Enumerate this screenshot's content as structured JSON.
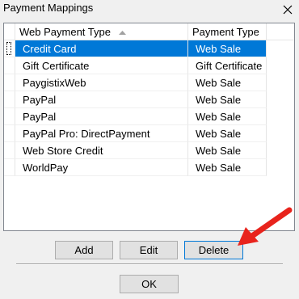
{
  "window": {
    "title": "Payment Mappings",
    "close_glyph": "✕"
  },
  "list": {
    "columns": [
      {
        "label": "Web Payment Type",
        "sort": "ascending"
      },
      {
        "label": "Payment Type"
      }
    ],
    "rows": [
      {
        "web_payment_type": "Credit Card",
        "payment_type": "Web Sale",
        "selected": true
      },
      {
        "web_payment_type": "Gift Certificate",
        "payment_type": "Gift Certificate"
      },
      {
        "web_payment_type": "PaygistixWeb",
        "payment_type": "Web Sale"
      },
      {
        "web_payment_type": "PayPal",
        "payment_type": "Web Sale"
      },
      {
        "web_payment_type": "PayPal",
        "payment_type": "Web Sale"
      },
      {
        "web_payment_type": "PayPal Pro: DirectPayment",
        "payment_type": "Web Sale"
      },
      {
        "web_payment_type": "Web Store Credit",
        "payment_type": "Web Sale"
      },
      {
        "web_payment_type": "WorldPay",
        "payment_type": "Web Sale"
      }
    ]
  },
  "buttons": {
    "add": "Add",
    "edit": "Edit",
    "delete": "Delete",
    "ok": "OK"
  },
  "colors": {
    "selection": "#0078d7",
    "annotation_arrow": "#e8231c"
  },
  "annotation": {
    "icon": "red-arrow-icon",
    "points_to": "delete-button"
  }
}
